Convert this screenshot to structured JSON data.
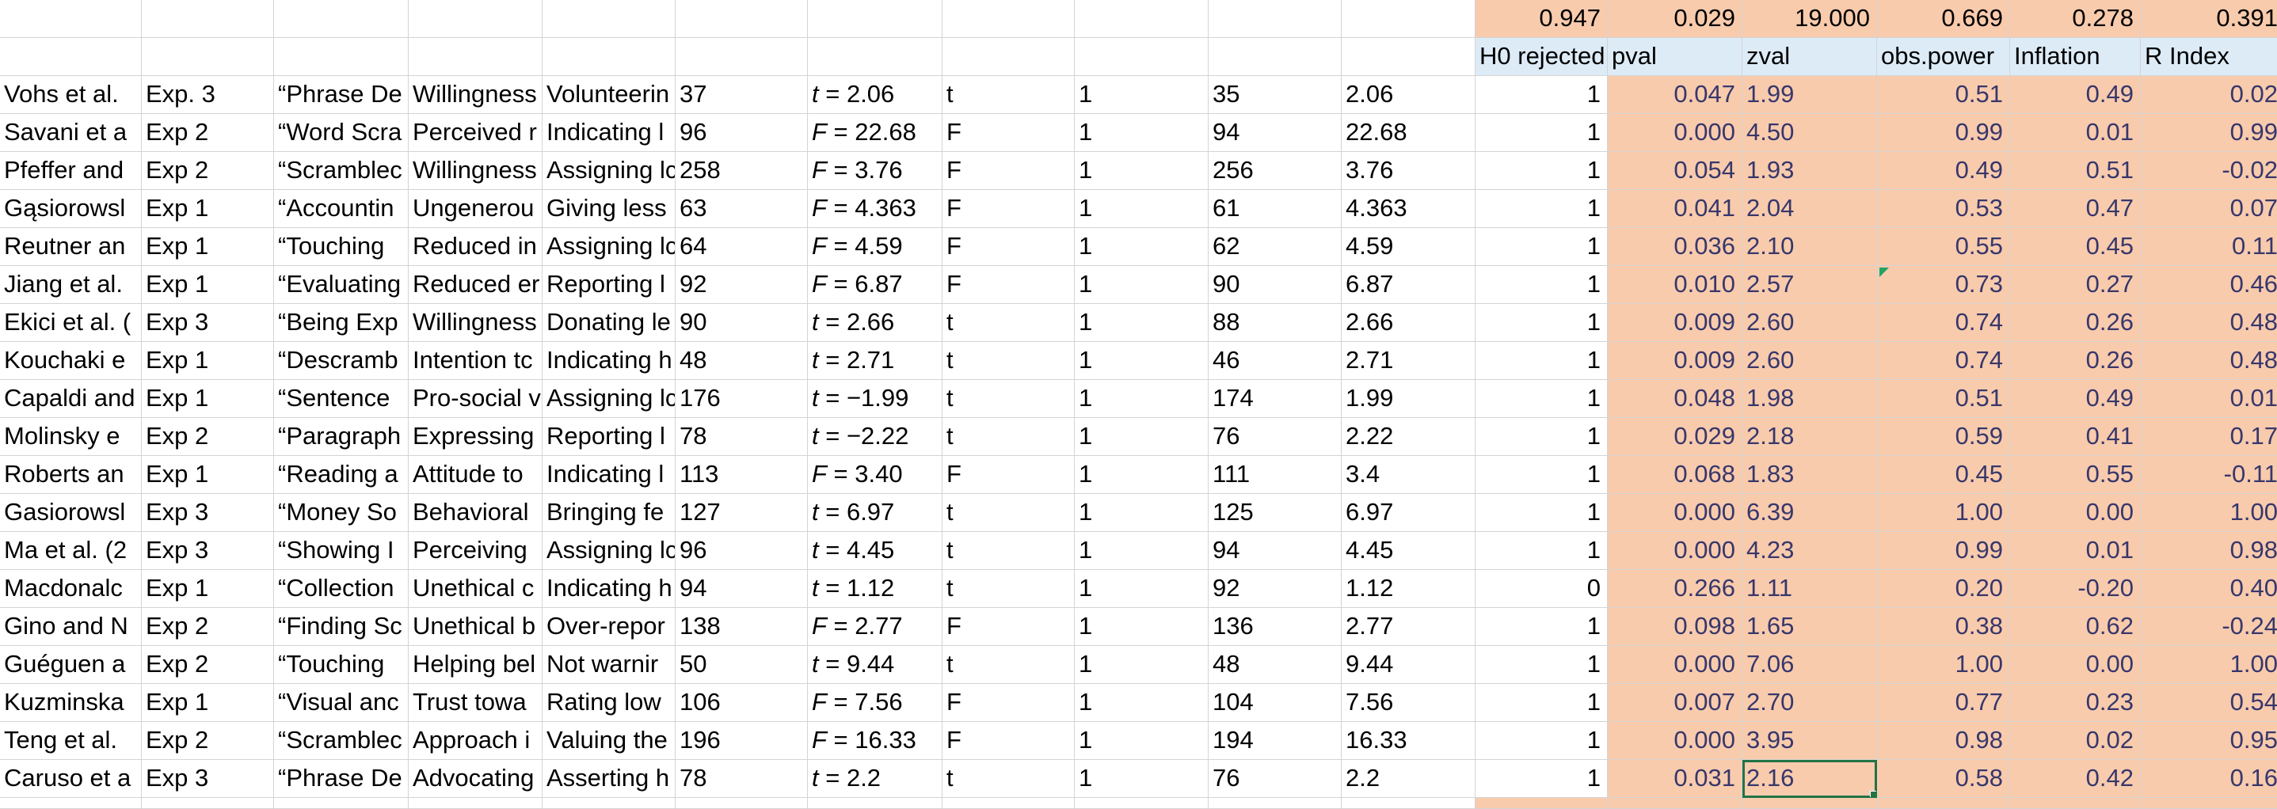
{
  "summary_row": [
    "0.947",
    "0.029",
    "19.000",
    "0.669",
    "0.278",
    "0.391"
  ],
  "headers": {
    "h0_rejected": "H0 rejected",
    "pval": "pval",
    "zval": "zval",
    "obs_power": "obs.power",
    "inflation": "Inflation",
    "r_index": "R Index"
  },
  "rows": [
    {
      "study": "Vohs et al.",
      "exp": "Exp. 3",
      "manip": "“Phrase De",
      "dv1": "Willingness",
      "dv2": "Volunteerin",
      "n": "37",
      "stat_sym": "t",
      "stat_rest": " = 2.06",
      "type": "t",
      "df1": "1",
      "df2": "35",
      "val": "2.06",
      "h0": "1",
      "pval": "0.047",
      "zval": "1.99",
      "power": "0.51",
      "inflation": "0.49",
      "rindex": "0.02"
    },
    {
      "study": "Savani et a",
      "exp": "Exp 2",
      "manip": "“Word Scra",
      "dv1": "Perceived r",
      "dv2": "Indicating l",
      "n": "96",
      "stat_sym": "F",
      "stat_rest": " = 22.68",
      "type": "F",
      "df1": "1",
      "df2": "94",
      "val": "22.68",
      "h0": "1",
      "pval": "0.000",
      "zval": "4.50",
      "power": "0.99",
      "inflation": "0.01",
      "rindex": "0.99"
    },
    {
      "study": "Pfeffer and",
      "exp": "Exp 2",
      "manip": "“Scramblec",
      "dv1": "Willingness",
      "dv2": "Assigning lc",
      "n": "258",
      "stat_sym": "F",
      "stat_rest": " = 3.76",
      "type": "F",
      "df1": "1",
      "df2": "256",
      "val": "3.76",
      "h0": "1",
      "pval": "0.054",
      "zval": "1.93",
      "power": "0.49",
      "inflation": "0.51",
      "rindex": "-0.02"
    },
    {
      "study": "Gąsiorowsl",
      "exp": "Exp 1",
      "manip": "“Accountin",
      "dv1": "Ungenerou",
      "dv2": "Giving less",
      "n": "63",
      "stat_sym": "F",
      "stat_rest": " = 4.363",
      "type": "F",
      "df1": "1",
      "df2": "61",
      "val": "4.363",
      "h0": "1",
      "pval": "0.041",
      "zval": "2.04",
      "power": "0.53",
      "inflation": "0.47",
      "rindex": "0.07"
    },
    {
      "study": "Reutner an",
      "exp": "Exp 1",
      "manip": "“Touching",
      "dv1": "Reduced in",
      "dv2": "Assigning lc",
      "n": "64",
      "stat_sym": "F",
      "stat_rest": " = 4.59",
      "type": "F",
      "df1": "1",
      "df2": "62",
      "val": "4.59",
      "h0": "1",
      "pval": "0.036",
      "zval": "2.10",
      "power": "0.55",
      "inflation": "0.45",
      "rindex": "0.11"
    },
    {
      "study": "Jiang et al.",
      "exp": "Exp 1",
      "manip": "“Evaluating",
      "dv1": "Reduced er",
      "dv2": "Reporting l",
      "n": "92",
      "stat_sym": "F",
      "stat_rest": " = 6.87",
      "type": "F",
      "df1": "1",
      "df2": "90",
      "val": "6.87",
      "h0": "1",
      "pval": "0.010",
      "zval": "2.57",
      "power": "0.73",
      "inflation": "0.27",
      "rindex": "0.46"
    },
    {
      "study": "Ekici et al. (",
      "exp": "Exp 3",
      "manip": "“Being Exp",
      "dv1": "Willingness",
      "dv2": "Donating le",
      "n": "90",
      "stat_sym": "t",
      "stat_rest": " = 2.66",
      "type": "t",
      "df1": "1",
      "df2": "88",
      "val": "2.66",
      "h0": "1",
      "pval": "0.009",
      "zval": "2.60",
      "power": "0.74",
      "inflation": "0.26",
      "rindex": "0.48"
    },
    {
      "study": "Kouchaki e",
      "exp": "Exp 1",
      "manip": "“Descramb",
      "dv1": "Intention tc",
      "dv2": "Indicating h",
      "n": "48",
      "stat_sym": "t",
      "stat_rest": " = 2.71",
      "type": "t",
      "df1": "1",
      "df2": "46",
      "val": "2.71",
      "h0": "1",
      "pval": "0.009",
      "zval": "2.60",
      "power": "0.74",
      "inflation": "0.26",
      "rindex": "0.48"
    },
    {
      "study": "Capaldi and",
      "exp": "Exp 1",
      "manip": "“Sentence",
      "dv1": "Pro-social v",
      "dv2": "Assigning lc",
      "n": "176",
      "stat_sym": "t",
      "stat_rest": " = −1.99",
      "type": "t",
      "df1": "1",
      "df2": "174",
      "val": "1.99",
      "h0": "1",
      "pval": "0.048",
      "zval": "1.98",
      "power": "0.51",
      "inflation": "0.49",
      "rindex": "0.01"
    },
    {
      "study": "Molinsky e",
      "exp": "Exp 2",
      "manip": "“Paragraph",
      "dv1": "Expressing",
      "dv2": "Reporting l",
      "n": "78",
      "stat_sym": "t",
      "stat_rest": " = −2.22",
      "type": "t",
      "df1": "1",
      "df2": "76",
      "val": "2.22",
      "h0": "1",
      "pval": "0.029",
      "zval": "2.18",
      "power": "0.59",
      "inflation": "0.41",
      "rindex": "0.17"
    },
    {
      "study": "Roberts an",
      "exp": "Exp 1",
      "manip": "“Reading a",
      "dv1": "Attitude to",
      "dv2": "Indicating l",
      "n": "113",
      "stat_sym": "F",
      "stat_rest": " = 3.40",
      "type": "F",
      "df1": "1",
      "df2": "111",
      "val": "3.4",
      "h0": "1",
      "pval": "0.068",
      "zval": "1.83",
      "power": "0.45",
      "inflation": "0.55",
      "rindex": "-0.11"
    },
    {
      "study": "Gasiorowsl",
      "exp": "Exp 3",
      "manip": "“Money So",
      "dv1": "Behavioral",
      "dv2": "Bringing fe",
      "n": "127",
      "stat_sym": "t",
      "stat_rest": " = 6.97",
      "type": "t",
      "df1": "1",
      "df2": "125",
      "val": "6.97",
      "h0": "1",
      "pval": "0.000",
      "zval": "6.39",
      "power": "1.00",
      "inflation": "0.00",
      "rindex": "1.00"
    },
    {
      "study": "Ma et al. (2",
      "exp": "Exp 3",
      "manip": "“Showing I",
      "dv1": "Perceiving",
      "dv2": "Assigning lc",
      "n": "96",
      "stat_sym": "t",
      "stat_rest": " = 4.45",
      "type": "t",
      "df1": "1",
      "df2": "94",
      "val": "4.45",
      "h0": "1",
      "pval": "0.000",
      "zval": "4.23",
      "power": "0.99",
      "inflation": "0.01",
      "rindex": "0.98"
    },
    {
      "study": "Macdonalc",
      "exp": "Exp 1",
      "manip": "“Collection",
      "dv1": "Unethical c",
      "dv2": "Indicating h",
      "n": "94",
      "stat_sym": "t",
      "stat_rest": " = 1.12",
      "type": "t",
      "df1": "1",
      "df2": "92",
      "val": "1.12",
      "h0": "0",
      "pval": "0.266",
      "zval": "1.11",
      "power": "0.20",
      "inflation": "-0.20",
      "rindex": "0.40"
    },
    {
      "study": "Gino and N",
      "exp": "Exp 2",
      "manip": "“Finding Sc",
      "dv1": "Unethical b",
      "dv2": "Over-repor",
      "n": "138",
      "stat_sym": "F",
      "stat_rest": " = 2.77",
      "type": "F",
      "df1": "1",
      "df2": "136",
      "val": "2.77",
      "h0": "1",
      "pval": "0.098",
      "zval": "1.65",
      "power": "0.38",
      "inflation": "0.62",
      "rindex": "-0.24"
    },
    {
      "study": "Guéguen a",
      "exp": "Exp 2",
      "manip": "“Touching",
      "dv1": "Helping bel",
      "dv2": "Not warnir",
      "n": "50",
      "stat_sym": "t",
      "stat_rest": " = 9.44",
      "type": "t",
      "df1": "1",
      "df2": "48",
      "val": "9.44",
      "h0": "1",
      "pval": "0.000",
      "zval": "7.06",
      "power": "1.00",
      "inflation": "0.00",
      "rindex": "1.00"
    },
    {
      "study": "Kuzminska",
      "exp": "Exp 1",
      "manip": "“Visual anc",
      "dv1": "Trust towa",
      "dv2": "Rating low",
      "n": "106",
      "stat_sym": "F",
      "stat_rest": " = 7.56",
      "type": "F",
      "df1": "1",
      "df2": "104",
      "val": "7.56",
      "h0": "1",
      "pval": "0.007",
      "zval": "2.70",
      "power": "0.77",
      "inflation": "0.23",
      "rindex": "0.54"
    },
    {
      "study": "Teng et al.",
      "exp": "Exp 2",
      "manip": "“Scramblec",
      "dv1": "Approach i",
      "dv2": "Valuing the",
      "n": "196",
      "stat_sym": "F",
      "stat_rest": " = 16.33",
      "type": "F",
      "df1": "1",
      "df2": "194",
      "val": "16.33",
      "h0": "1",
      "pval": "0.000",
      "zval": "3.95",
      "power": "0.98",
      "inflation": "0.02",
      "rindex": "0.95"
    },
    {
      "study": "Caruso et a",
      "exp": "Exp 3",
      "manip": "“Phrase De",
      "dv1": "Advocating",
      "dv2": "Asserting h",
      "n": "78",
      "stat_sym": "t",
      "stat_rest": " = 2.2",
      "type": "t",
      "df1": "1",
      "df2": "76",
      "val": "2.2",
      "h0": "1",
      "pval": "0.031",
      "zval": "2.16",
      "power": "0.58",
      "inflation": "0.42",
      "rindex": "0.16"
    }
  ],
  "colors": {
    "summary_fill": "#f8cbad",
    "header_fill": "#ddebf7",
    "computed_fill": "#f8cbad",
    "computed_text": "#37376b",
    "selection": "#217346",
    "gridline": "#d4d4d4"
  }
}
